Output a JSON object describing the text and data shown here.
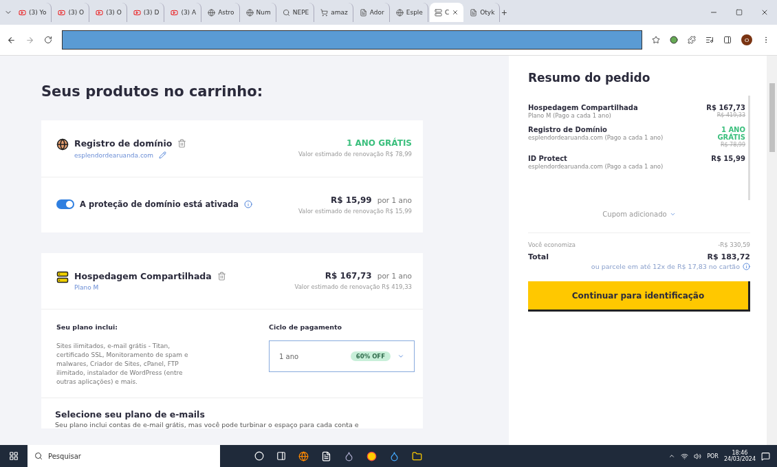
{
  "browser": {
    "tabs": [
      {
        "label": "(3) Yo",
        "kind": "video",
        "selected": false
      },
      {
        "label": "(3) O",
        "kind": "video",
        "selected": false
      },
      {
        "label": "(3) O",
        "kind": "video",
        "selected": false
      },
      {
        "label": "(3) D",
        "kind": "video",
        "selected": false
      },
      {
        "label": "(3) A",
        "kind": "video",
        "selected": false
      },
      {
        "label": "Astro",
        "kind": "globe",
        "selected": false
      },
      {
        "label": "Num",
        "kind": "globe",
        "selected": false
      },
      {
        "label": "NEPE",
        "kind": "search",
        "selected": false
      },
      {
        "label": "amaz",
        "kind": "shop",
        "selected": false
      },
      {
        "label": "Ador",
        "kind": "wiki",
        "selected": false
      },
      {
        "label": "Esple",
        "kind": "globe",
        "selected": false
      },
      {
        "label": "C",
        "kind": "site",
        "selected": true
      },
      {
        "label": "Otyk",
        "kind": "wiki",
        "selected": false
      }
    ],
    "new_tab": "+",
    "profile_initial": "O"
  },
  "cart": {
    "title": "Seus produtos no carrinho:",
    "domain": {
      "title": "Registro de domínio",
      "domain": "esplendordearuanda.com",
      "price": "1 ANO GRÁTIS",
      "renewal": "Valor estimado de renovação R$ 78,99"
    },
    "protection": {
      "label": "A proteção de domínio está ativada",
      "on": true,
      "price": "R$ 15,99",
      "period": "por 1 ano",
      "renewal": "Valor estimado de renovação R$ 15,99"
    },
    "hosting": {
      "title": "Hospedagem Compartilhada",
      "plan": "Plano M",
      "price": "R$ 167,73",
      "period": "por 1 ano",
      "renewal": "Valor estimado de renovação R$ 419,33",
      "includes_title": "Seu plano inclui:",
      "includes": "Sites ilimitados, e-mail grátis - Titan, certificado SSL, Monitoramento de spam e malwares, Criador de Sites, cPanel, FTP ilimitado, instalador de WordPress (entre outras aplicações) e mais.",
      "cycle_title": "Ciclo de pagamento",
      "cycle_value": "1 ano",
      "cycle_badge": "60% OFF"
    },
    "email": {
      "title": "Selecione seu plano de e-mails",
      "text": "Seu plano inclui contas de e-mail grátis, mas você pode turbinar o espaço para cada conta e"
    }
  },
  "summary": {
    "title": "Resumo do pedido",
    "items": [
      {
        "name": "Hospedagem Compartilhada",
        "detail": "Plano M (Pago a cada 1 ano)",
        "price": "R$ 167,73",
        "old_price": "R$ 419,33",
        "free": false
      },
      {
        "name": "Registro de Domínio",
        "detail": "esplendordearuanda.com (Pago a cada 1 ano)",
        "price": "1 ANO GRÁTIS",
        "old_price": "R$ 78,99",
        "free": true
      },
      {
        "name": "ID Protect",
        "detail": "esplendordearuanda.com (Pago a cada 1 ano)",
        "price": "R$ 15,99",
        "free": false
      }
    ],
    "coupon": "Cupom adicionado",
    "savings_label": "Você economiza",
    "savings": "-R$ 330,59",
    "total_label": "Total",
    "total": "R$ 183,72",
    "installments": "ou parcele em até 12x de R$ 17,83 no cartão",
    "button": "Continuar para identificação"
  },
  "taskbar": {
    "search": "Pesquisar",
    "language": "POR",
    "time": "18:46",
    "date": "24/03/2024"
  }
}
